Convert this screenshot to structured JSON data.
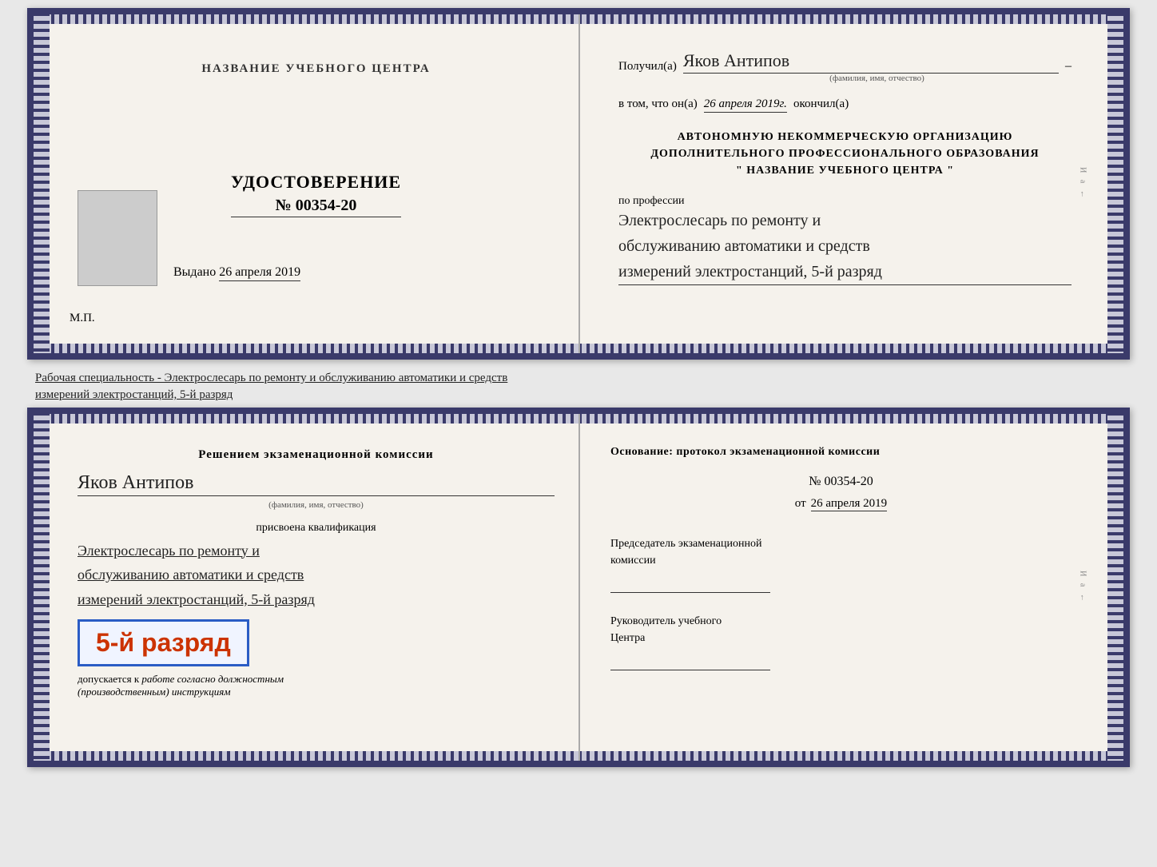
{
  "top_document": {
    "left": {
      "center_name": "НАЗВАНИЕ УЧЕБНОГО ЦЕНТРА",
      "cert_label": "УДОСТОВЕРЕНИЕ",
      "cert_number": "№ 00354-20",
      "issued_label": "Выдано",
      "issued_date": "26 апреля 2019",
      "mp_label": "М.П."
    },
    "right": {
      "recipient_label": "Получил(а)",
      "recipient_name": "Яков Антипов",
      "fio_subtitle": "(фамилия, имя, отчество)",
      "completed_label": "в том, что он(а)",
      "completed_date": "26 апреля 2019г.",
      "completed_suffix": "окончил(а)",
      "org_line1": "АВТОНОМНУЮ НЕКОММЕРЧЕСКУЮ ОРГАНИЗАЦИЮ",
      "org_line2": "ДОПОЛНИТЕЛЬНОГО ПРОФЕССИОНАЛЬНОГО ОБРАЗОВАНИЯ",
      "org_line3": "\"  НАЗВАНИЕ УЧЕБНОГО ЦЕНТРА  \"",
      "profession_label": "по профессии",
      "profession_text_line1": "Электрослесарь по ремонту и",
      "profession_text_line2": "обслуживанию автоматики и средств",
      "profession_text_line3": "измерений электростанций, 5-й разряд"
    }
  },
  "middle_text": {
    "line1": "Рабочая специальность - Электрослесарь по ремонту и обслуживанию автоматики и средств",
    "line2": "измерений электростанций, 5-й разряд"
  },
  "bottom_document": {
    "left": {
      "commission_title": "Решением экзаменационной комиссии",
      "person_name": "Яков Антипов",
      "fio_subtitle": "(фамилия, имя, отчество)",
      "qualification_label": "присвоена квалификация",
      "qual_line1": "Электрослесарь по ремонту и",
      "qual_line2": "обслуживанию автоматики и средств",
      "qual_line3": "измерений электростанций, 5-й разряд",
      "rank_text": "5-й разряд",
      "допускается_label": "допускается к",
      "допускается_text": "работе согласно должностным",
      "допускается_text2": "(производственным) инструкциям"
    },
    "right": {
      "osnov_label": "Основание: протокол экзаменационной комиссии",
      "number_row": "№  00354-20",
      "date_prefix": "от",
      "date_value": "26 апреля 2019",
      "predsedatel_label": "Председатель экзаменационной",
      "predsedatel_label2": "комиссии",
      "rukov_label": "Руководитель учебного",
      "rukov_label2": "Центра"
    }
  }
}
